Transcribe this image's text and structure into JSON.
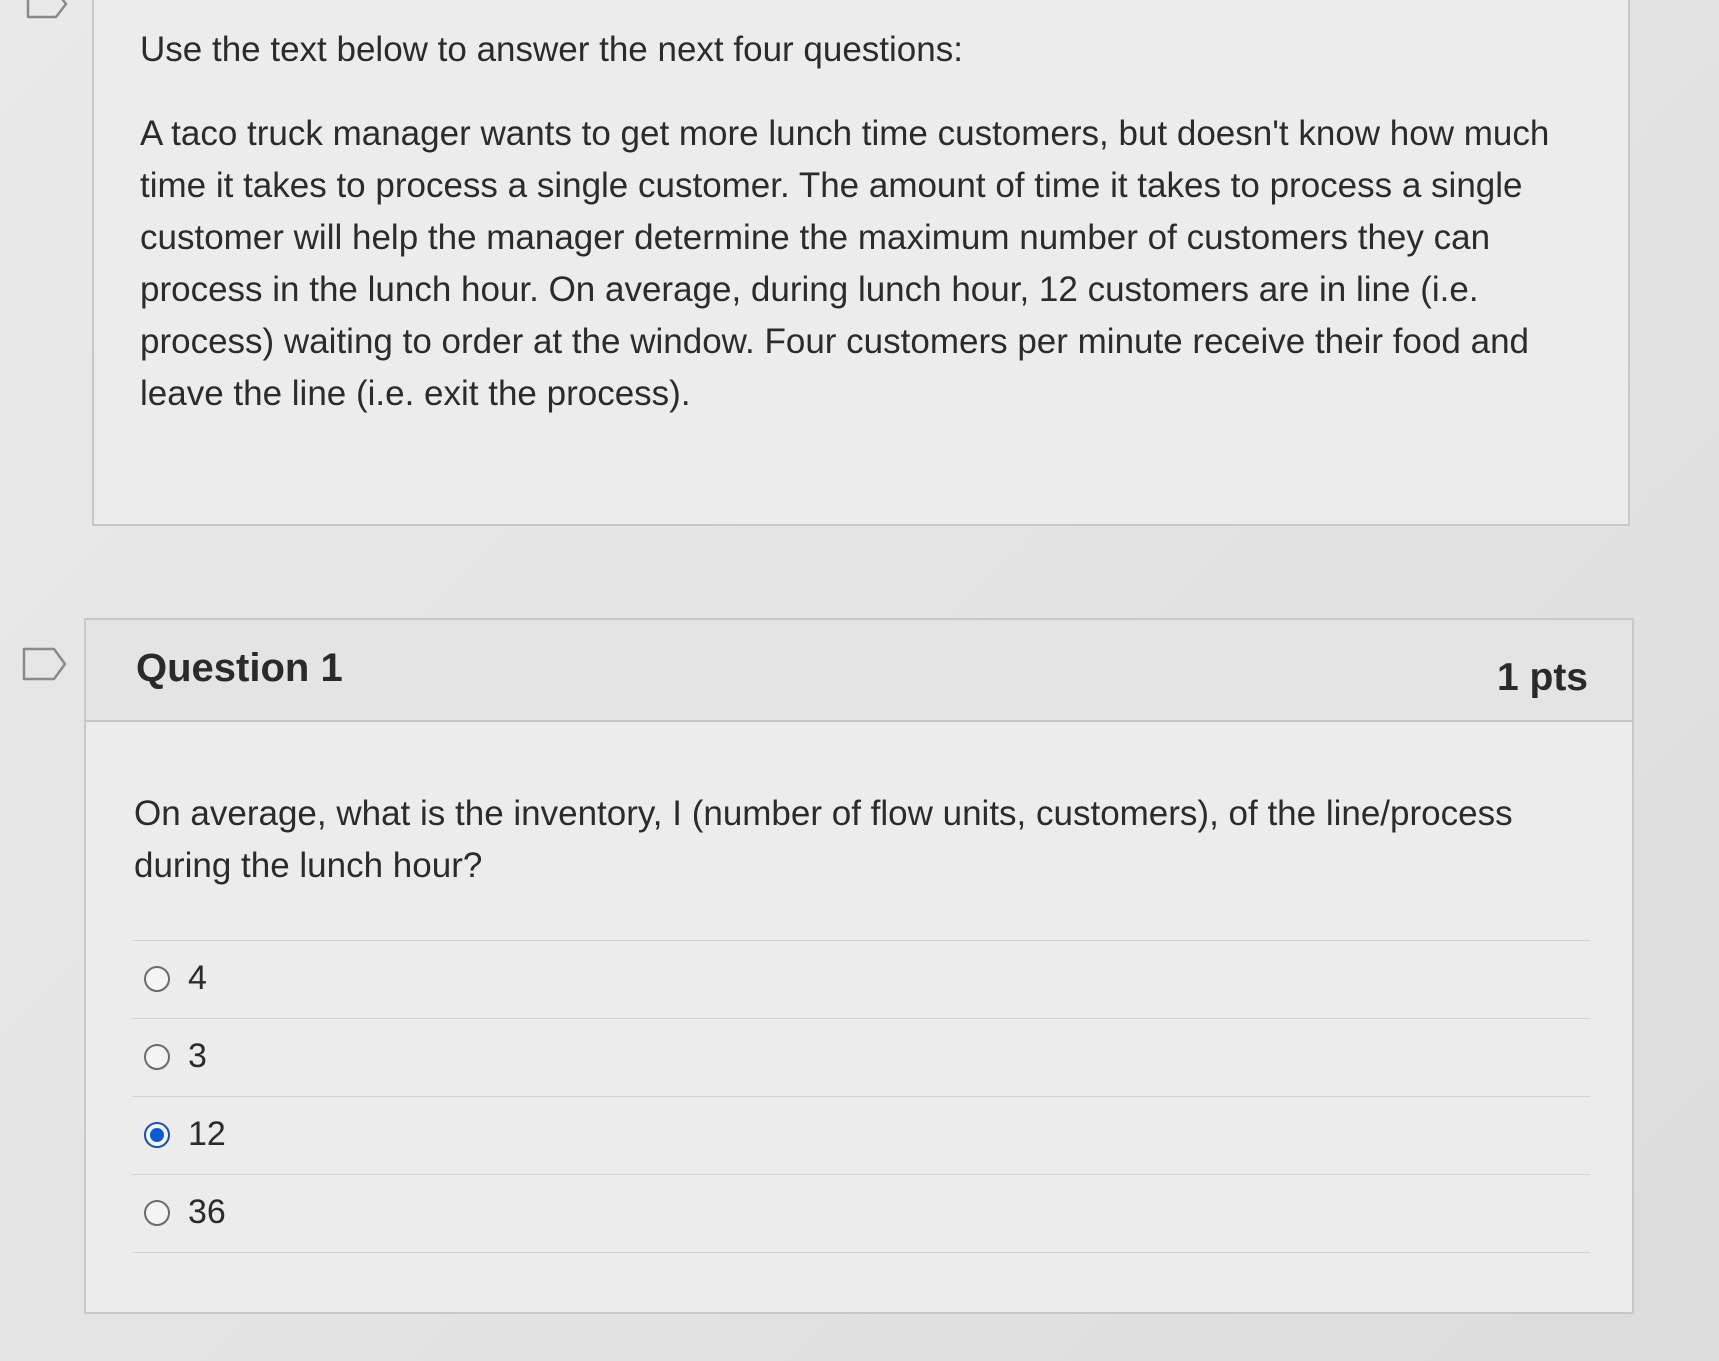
{
  "text_panel": {
    "intro": "Use the text below to answer the next four questions:",
    "body": "A taco truck manager wants to get more lunch time customers, but doesn't know how much time it takes to process a single customer. The amount of time it takes to process a single customer will help the manager determine the maximum number of customers they can process in the lunch hour. On average, during lunch hour, 12 customers are in line (i.e. process) waiting to order at the window. Four customers per minute receive their food and leave the line (i.e. exit the process)."
  },
  "question": {
    "title": "Question 1",
    "points": "1 pts",
    "text": "On average, what is the inventory, I (number of flow units, customers), of the line/process during the lunch hour?",
    "answers": [
      {
        "label": "4",
        "selected": false
      },
      {
        "label": "3",
        "selected": false
      },
      {
        "label": "12",
        "selected": true
      },
      {
        "label": "36",
        "selected": false
      }
    ]
  },
  "colors": {
    "selected_radio": "#0b5bd1",
    "panel_border": "#c8c8c8",
    "text": "#2b2b2b"
  },
  "icons": [
    "flag-question-icon",
    "radio-button-icon"
  ]
}
